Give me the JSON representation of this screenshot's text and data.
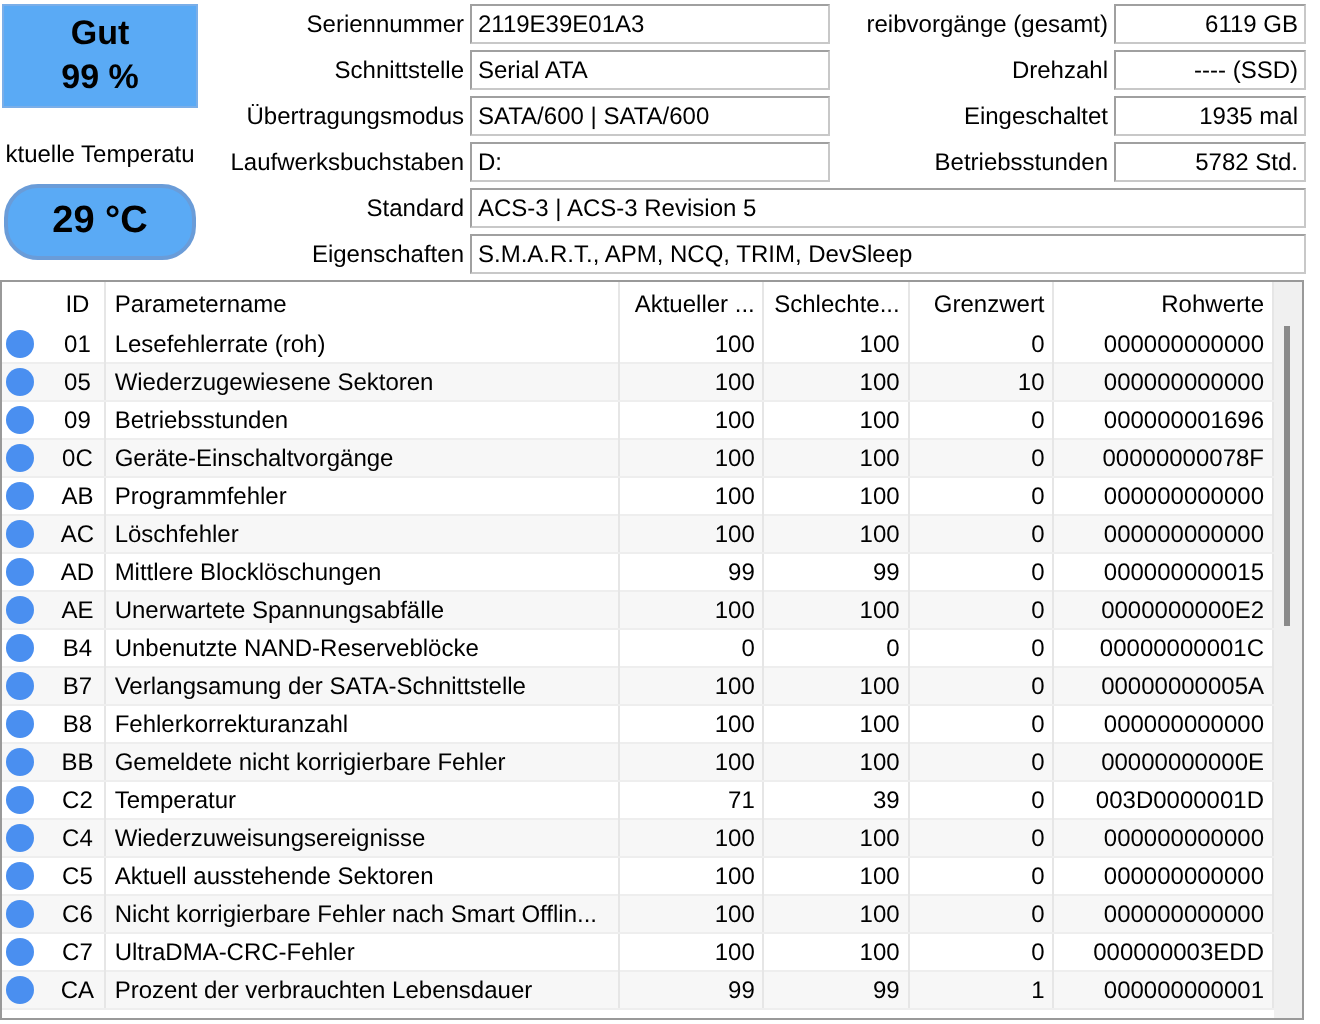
{
  "health": {
    "color": "#5aaaf5",
    "label": "Gut",
    "percent": "99 %"
  },
  "temperature": {
    "label": "ktuelle Temperatu",
    "value": "29 °C",
    "color": "#5aaaf5"
  },
  "info_left": [
    {
      "label": "Seriennummer",
      "value": "2119E39E01A3"
    },
    {
      "label": "Schnittstelle",
      "value": "Serial ATA"
    },
    {
      "label": "Übertragungsmodus",
      "value": "SATA/600 | SATA/600"
    },
    {
      "label": "Laufwerksbuchstaben",
      "value": "D:"
    }
  ],
  "info_right": [
    {
      "label": "reibvorgänge (gesamt)",
      "value": "6119 GB"
    },
    {
      "label": "Drehzahl",
      "value": "---- (SSD)"
    },
    {
      "label": "Eingeschaltet",
      "value": "1935 mal"
    },
    {
      "label": "Betriebsstunden",
      "value": "5782 Std."
    }
  ],
  "info_wide": [
    {
      "label": "Standard",
      "value": "ACS-3 | ACS-3 Revision 5"
    },
    {
      "label": "Eigenschaften",
      "value": "S.M.A.R.T., APM, NCQ, TRIM, DevSleep"
    }
  ],
  "table": {
    "columns": [
      "ID",
      "Parametername",
      "Aktueller ...",
      "Schlechte...",
      "Grenzwert",
      "Rohwerte"
    ],
    "rows": [
      {
        "color": "#4a8ff0",
        "id": "01",
        "name": "Lesefehlerrate (roh)",
        "current": "100",
        "worst": "100",
        "threshold": "0",
        "raw": "000000000000"
      },
      {
        "color": "#4a8ff0",
        "id": "05",
        "name": "Wiederzugewiesene Sektoren",
        "current": "100",
        "worst": "100",
        "threshold": "10",
        "raw": "000000000000"
      },
      {
        "color": "#4a8ff0",
        "id": "09",
        "name": "Betriebsstunden",
        "current": "100",
        "worst": "100",
        "threshold": "0",
        "raw": "000000001696"
      },
      {
        "color": "#4a8ff0",
        "id": "0C",
        "name": "Geräte-Einschaltvorgänge",
        "current": "100",
        "worst": "100",
        "threshold": "0",
        "raw": "00000000078F"
      },
      {
        "color": "#4a8ff0",
        "id": "AB",
        "name": "Programmfehler",
        "current": "100",
        "worst": "100",
        "threshold": "0",
        "raw": "000000000000"
      },
      {
        "color": "#4a8ff0",
        "id": "AC",
        "name": "Löschfehler",
        "current": "100",
        "worst": "100",
        "threshold": "0",
        "raw": "000000000000"
      },
      {
        "color": "#4a8ff0",
        "id": "AD",
        "name": "Mittlere Blocklöschungen",
        "current": "99",
        "worst": "99",
        "threshold": "0",
        "raw": "000000000015"
      },
      {
        "color": "#4a8ff0",
        "id": "AE",
        "name": "Unerwartete Spannungsabfälle",
        "current": "100",
        "worst": "100",
        "threshold": "0",
        "raw": "0000000000E2"
      },
      {
        "color": "#4a8ff0",
        "id": "B4",
        "name": "Unbenutzte NAND-Reserveblöcke",
        "current": "0",
        "worst": "0",
        "threshold": "0",
        "raw": "00000000001C"
      },
      {
        "color": "#4a8ff0",
        "id": "B7",
        "name": "Verlangsamung der SATA-Schnittstelle",
        "current": "100",
        "worst": "100",
        "threshold": "0",
        "raw": "00000000005A"
      },
      {
        "color": "#4a8ff0",
        "id": "B8",
        "name": "Fehlerkorrekturanzahl",
        "current": "100",
        "worst": "100",
        "threshold": "0",
        "raw": "000000000000"
      },
      {
        "color": "#4a8ff0",
        "id": "BB",
        "name": "Gemeldete nicht korrigierbare Fehler",
        "current": "100",
        "worst": "100",
        "threshold": "0",
        "raw": "00000000000E"
      },
      {
        "color": "#4a8ff0",
        "id": "C2",
        "name": "Temperatur",
        "current": "71",
        "worst": "39",
        "threshold": "0",
        "raw": "003D0000001D"
      },
      {
        "color": "#4a8ff0",
        "id": "C4",
        "name": "Wiederzuweisungsereignisse",
        "current": "100",
        "worst": "100",
        "threshold": "0",
        "raw": "000000000000"
      },
      {
        "color": "#4a8ff0",
        "id": "C5",
        "name": "Aktuell ausstehende Sektoren",
        "current": "100",
        "worst": "100",
        "threshold": "0",
        "raw": "000000000000"
      },
      {
        "color": "#4a8ff0",
        "id": "C6",
        "name": "Nicht korrigierbare Fehler nach Smart Offlin...",
        "current": "100",
        "worst": "100",
        "threshold": "0",
        "raw": "000000000000"
      },
      {
        "color": "#4a8ff0",
        "id": "C7",
        "name": "UltraDMA-CRC-Fehler",
        "current": "100",
        "worst": "100",
        "threshold": "0",
        "raw": "000000003EDD"
      },
      {
        "color": "#4a8ff0",
        "id": "CA",
        "name": "Prozent der verbrauchten Lebensdauer",
        "current": "99",
        "worst": "99",
        "threshold": "1",
        "raw": "000000000001"
      }
    ]
  }
}
